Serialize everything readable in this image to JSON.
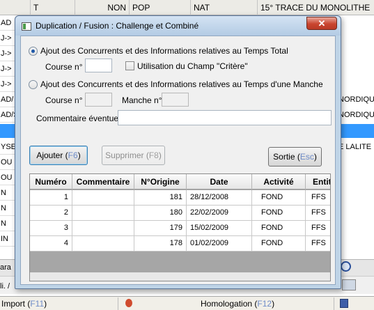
{
  "background": {
    "headers": [
      "T",
      "NON",
      "POP"
    ],
    "header_overflow": [
      "NAT",
      "15° TRACE DU MONOLITHE"
    ],
    "left_cells": [
      "AD",
      "J->",
      "J->",
      "J->",
      "J->",
      "AD/",
      "AD/S",
      "YSEN",
      "OU",
      "OU",
      "N",
      "N",
      "N",
      "IN"
    ],
    "right_cells": [
      "NORDIQU",
      "NORDIQU",
      "E LALITE"
    ],
    "bottom_left_1": "ara",
    "bottom_left_2": "li. /",
    "status": {
      "import_label": "Import (",
      "import_key": "F11",
      "import_close": ")",
      "homologation_label": "Homologation (",
      "homologation_key": "F12",
      "homologation_close": ")"
    }
  },
  "dialog": {
    "title": "Duplication / Fusion : Challenge et Combiné",
    "close_label": "✕",
    "option_total": "Ajout des Concurrents et  des Informations relatives au Temps Total",
    "course_label": "Course n°",
    "course_value": "",
    "checkbox_label": "Utilisation du Champ \"Critère\"",
    "option_manche": "Ajout des Concurrents et  des Informations relatives au Temps d'une Manche",
    "course_label_2": "Course n°",
    "manche_label": "Manche n°",
    "comment_label": "Commentaire éventuelle",
    "comment_value": "",
    "buttons": {
      "ajouter": "Ajouter (",
      "ajouter_key": "F6",
      "supprimer": "Supprimer (",
      "supprimer_key": "F8",
      "sortie": "Sortie (",
      "sortie_key": "Esc",
      "close_paren": ")"
    }
  },
  "grid": {
    "columns": [
      "Numéro",
      "Commentaire",
      "N°Origine",
      "Date",
      "Activité",
      "Entit"
    ],
    "rows": [
      {
        "numero": "1",
        "commentaire": "",
        "origine": "181",
        "date": "28/12/2008",
        "activite": "FOND",
        "entite": "FFS"
      },
      {
        "numero": "2",
        "commentaire": "",
        "origine": "180",
        "date": "22/02/2009",
        "activite": "FOND",
        "entite": "FFS"
      },
      {
        "numero": "3",
        "commentaire": "",
        "origine": "179",
        "date": "15/02/2009",
        "activite": "FOND",
        "entite": "FFS"
      },
      {
        "numero": "4",
        "commentaire": "",
        "origine": "178",
        "date": "01/02/2009",
        "activite": "FOND",
        "entite": "FFS"
      }
    ]
  },
  "colors": {
    "selection": "#3399ff",
    "dialog_frame": "#bfd4e7",
    "close_button": "#c9452f",
    "function_key": "#6f8cc8"
  }
}
